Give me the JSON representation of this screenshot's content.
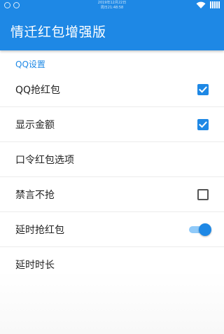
{
  "status_bar": {
    "line1": "2019年12月22日",
    "line2": "周日21:48:58"
  },
  "app": {
    "title": "情迁红包增强版"
  },
  "section": {
    "title": "QQ设置"
  },
  "prefs": [
    {
      "label": "QQ抢红包",
      "control": "checkbox",
      "checked": true
    },
    {
      "label": "显示金额",
      "control": "checkbox",
      "checked": true
    },
    {
      "label": "口令红包选项",
      "control": "none"
    },
    {
      "label": "禁言不抢",
      "control": "checkbox",
      "checked": false
    },
    {
      "label": "延时抢红包",
      "control": "switch",
      "on": true
    },
    {
      "label": "延时时长",
      "control": "none"
    }
  ],
  "colors": {
    "primary": "#1e88e5",
    "track": "#90caf9"
  }
}
